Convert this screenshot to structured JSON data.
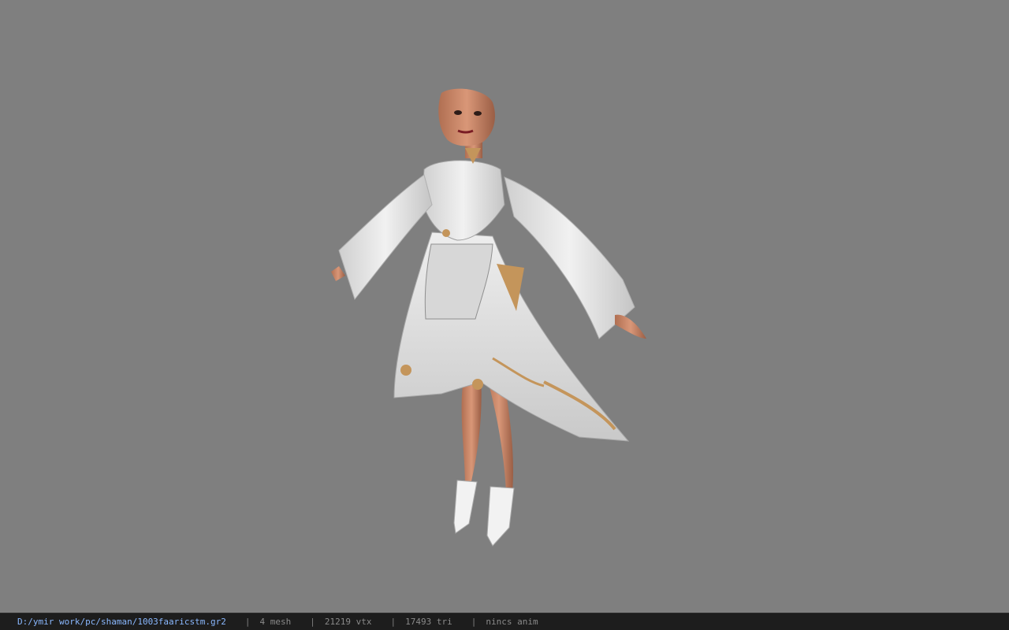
{
  "viewport": {
    "background_color": "#808080",
    "model_label": "character model"
  },
  "statusbar": {
    "file_path": "D:/ymir work/pc/shaman/1003faaricstm.gr2",
    "separator": "|",
    "mesh": "4 mesh",
    "vertices": "21219 vtx",
    "triangles": "17493 tri",
    "animation": "nincs anim",
    "path_color": "#8ab8ff",
    "text_color": "#8a8a8a"
  }
}
